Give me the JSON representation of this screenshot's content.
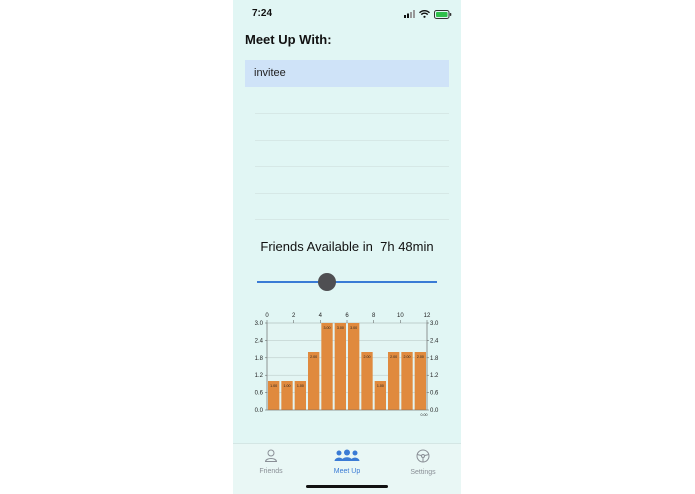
{
  "status": {
    "time": "7:24"
  },
  "header": {
    "title": "Meet Up With:"
  },
  "list": {
    "items": [
      "invitee"
    ]
  },
  "availability": {
    "label": "Friends Available in",
    "value": "7h 48min"
  },
  "slider": {
    "value_hours": 5,
    "min": 0,
    "max": 12
  },
  "chart_data": {
    "type": "bar",
    "x": [
      0.5,
      1.5,
      2.5,
      3.5,
      4.5,
      5.5,
      6.5,
      7.5,
      8.5,
      9.5,
      10.5,
      11.5
    ],
    "values": [
      1,
      1,
      1,
      2,
      3,
      3,
      3,
      2,
      1,
      2,
      2,
      2
    ],
    "value_labels": [
      "1.00",
      "1.00",
      "1.00",
      "2.00",
      "3.00",
      "3.00",
      "3.00",
      "2.00",
      "1.00",
      "2.00",
      "2.00",
      "2.00"
    ],
    "x_ticks": [
      "0",
      "2",
      "4",
      "6",
      "8",
      "10",
      "12"
    ],
    "y_ticks": [
      "0.0",
      "0.6",
      "1.2",
      "1.8",
      "2.4",
      "3.0"
    ],
    "ylim": [
      0,
      3
    ],
    "xlim": [
      0,
      12
    ],
    "corner_label": "0.00",
    "bar_color": "#e08a3e",
    "grid": true,
    "axes": {
      "left": true,
      "right": true,
      "top_ticks": true
    }
  },
  "tabs": [
    {
      "label": "Friends",
      "icon": "person-icon",
      "active": false
    },
    {
      "label": "Meet Up",
      "icon": "group-icon",
      "active": true
    },
    {
      "label": "Settings",
      "icon": "steering-wheel-icon",
      "active": false
    }
  ],
  "colors": {
    "background": "#e1f6f4",
    "accent": "#3a7bd5",
    "row_highlight": "#cfe3f8",
    "bar": "#e08a3e",
    "inactive_tab": "#8a8f96"
  }
}
